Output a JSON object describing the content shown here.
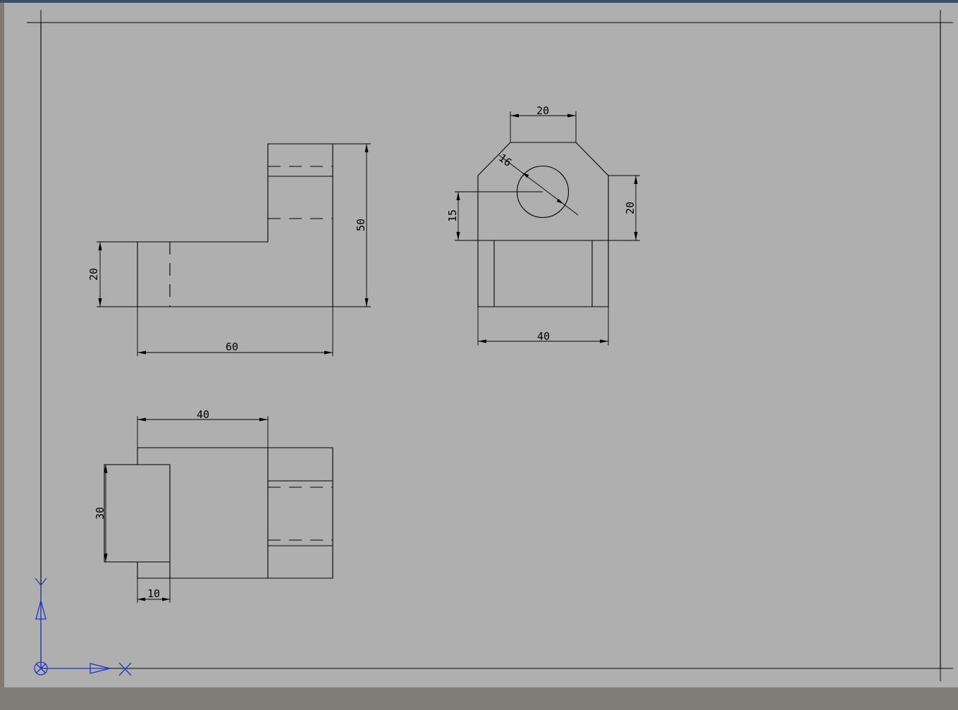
{
  "app": {
    "workspace": "AutoCAD-style model space",
    "colors": {
      "background": "#afafaf",
      "outer": "#7f7b77",
      "linework": "#000000",
      "ucs_icon": "#1f35c4"
    }
  },
  "views": {
    "front": {
      "dims": {
        "height_left": "20",
        "height_total": "50",
        "width_total": "60"
      }
    },
    "side": {
      "dims": {
        "top_width": "20",
        "radius": "16",
        "center_height_left": "15",
        "center_height_right": "20",
        "bottom_width": "40"
      }
    },
    "top": {
      "dims": {
        "width_top": "40",
        "height_left": "30",
        "notch_width": "10"
      }
    }
  },
  "ucs_icon": {
    "x_axis": "X",
    "y_axis": "Y",
    "icon": "ucs-icon"
  }
}
